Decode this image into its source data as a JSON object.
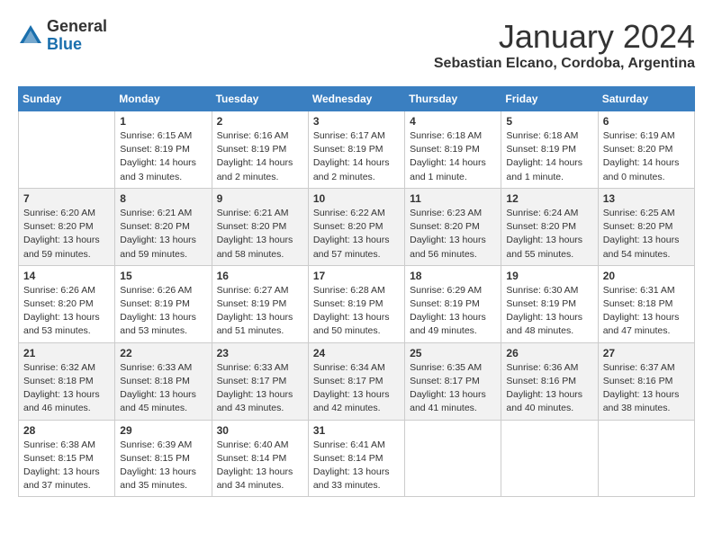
{
  "header": {
    "logo_general": "General",
    "logo_blue": "Blue",
    "main_title": "January 2024",
    "subtitle": "Sebastian Elcano, Cordoba, Argentina"
  },
  "calendar": {
    "days_of_week": [
      "Sunday",
      "Monday",
      "Tuesday",
      "Wednesday",
      "Thursday",
      "Friday",
      "Saturday"
    ],
    "weeks": [
      [
        {
          "day": "",
          "info": ""
        },
        {
          "day": "1",
          "info": "Sunrise: 6:15 AM\nSunset: 8:19 PM\nDaylight: 14 hours\nand 3 minutes."
        },
        {
          "day": "2",
          "info": "Sunrise: 6:16 AM\nSunset: 8:19 PM\nDaylight: 14 hours\nand 2 minutes."
        },
        {
          "day": "3",
          "info": "Sunrise: 6:17 AM\nSunset: 8:19 PM\nDaylight: 14 hours\nand 2 minutes."
        },
        {
          "day": "4",
          "info": "Sunrise: 6:18 AM\nSunset: 8:19 PM\nDaylight: 14 hours\nand 1 minute."
        },
        {
          "day": "5",
          "info": "Sunrise: 6:18 AM\nSunset: 8:19 PM\nDaylight: 14 hours\nand 1 minute."
        },
        {
          "day": "6",
          "info": "Sunrise: 6:19 AM\nSunset: 8:20 PM\nDaylight: 14 hours\nand 0 minutes."
        }
      ],
      [
        {
          "day": "7",
          "info": "Sunrise: 6:20 AM\nSunset: 8:20 PM\nDaylight: 13 hours\nand 59 minutes."
        },
        {
          "day": "8",
          "info": "Sunrise: 6:21 AM\nSunset: 8:20 PM\nDaylight: 13 hours\nand 59 minutes."
        },
        {
          "day": "9",
          "info": "Sunrise: 6:21 AM\nSunset: 8:20 PM\nDaylight: 13 hours\nand 58 minutes."
        },
        {
          "day": "10",
          "info": "Sunrise: 6:22 AM\nSunset: 8:20 PM\nDaylight: 13 hours\nand 57 minutes."
        },
        {
          "day": "11",
          "info": "Sunrise: 6:23 AM\nSunset: 8:20 PM\nDaylight: 13 hours\nand 56 minutes."
        },
        {
          "day": "12",
          "info": "Sunrise: 6:24 AM\nSunset: 8:20 PM\nDaylight: 13 hours\nand 55 minutes."
        },
        {
          "day": "13",
          "info": "Sunrise: 6:25 AM\nSunset: 8:20 PM\nDaylight: 13 hours\nand 54 minutes."
        }
      ],
      [
        {
          "day": "14",
          "info": "Sunrise: 6:26 AM\nSunset: 8:20 PM\nDaylight: 13 hours\nand 53 minutes."
        },
        {
          "day": "15",
          "info": "Sunrise: 6:26 AM\nSunset: 8:19 PM\nDaylight: 13 hours\nand 53 minutes."
        },
        {
          "day": "16",
          "info": "Sunrise: 6:27 AM\nSunset: 8:19 PM\nDaylight: 13 hours\nand 51 minutes."
        },
        {
          "day": "17",
          "info": "Sunrise: 6:28 AM\nSunset: 8:19 PM\nDaylight: 13 hours\nand 50 minutes."
        },
        {
          "day": "18",
          "info": "Sunrise: 6:29 AM\nSunset: 8:19 PM\nDaylight: 13 hours\nand 49 minutes."
        },
        {
          "day": "19",
          "info": "Sunrise: 6:30 AM\nSunset: 8:19 PM\nDaylight: 13 hours\nand 48 minutes."
        },
        {
          "day": "20",
          "info": "Sunrise: 6:31 AM\nSunset: 8:18 PM\nDaylight: 13 hours\nand 47 minutes."
        }
      ],
      [
        {
          "day": "21",
          "info": "Sunrise: 6:32 AM\nSunset: 8:18 PM\nDaylight: 13 hours\nand 46 minutes."
        },
        {
          "day": "22",
          "info": "Sunrise: 6:33 AM\nSunset: 8:18 PM\nDaylight: 13 hours\nand 45 minutes."
        },
        {
          "day": "23",
          "info": "Sunrise: 6:33 AM\nSunset: 8:17 PM\nDaylight: 13 hours\nand 43 minutes."
        },
        {
          "day": "24",
          "info": "Sunrise: 6:34 AM\nSunset: 8:17 PM\nDaylight: 13 hours\nand 42 minutes."
        },
        {
          "day": "25",
          "info": "Sunrise: 6:35 AM\nSunset: 8:17 PM\nDaylight: 13 hours\nand 41 minutes."
        },
        {
          "day": "26",
          "info": "Sunrise: 6:36 AM\nSunset: 8:16 PM\nDaylight: 13 hours\nand 40 minutes."
        },
        {
          "day": "27",
          "info": "Sunrise: 6:37 AM\nSunset: 8:16 PM\nDaylight: 13 hours\nand 38 minutes."
        }
      ],
      [
        {
          "day": "28",
          "info": "Sunrise: 6:38 AM\nSunset: 8:15 PM\nDaylight: 13 hours\nand 37 minutes."
        },
        {
          "day": "29",
          "info": "Sunrise: 6:39 AM\nSunset: 8:15 PM\nDaylight: 13 hours\nand 35 minutes."
        },
        {
          "day": "30",
          "info": "Sunrise: 6:40 AM\nSunset: 8:14 PM\nDaylight: 13 hours\nand 34 minutes."
        },
        {
          "day": "31",
          "info": "Sunrise: 6:41 AM\nSunset: 8:14 PM\nDaylight: 13 hours\nand 33 minutes."
        },
        {
          "day": "",
          "info": ""
        },
        {
          "day": "",
          "info": ""
        },
        {
          "day": "",
          "info": ""
        }
      ]
    ]
  }
}
